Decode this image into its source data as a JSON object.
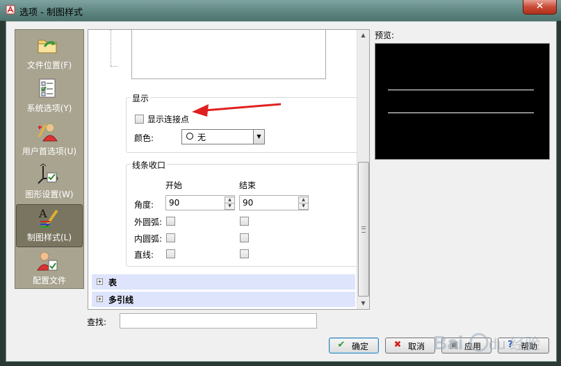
{
  "window": {
    "title": "选项 - 制图样式",
    "close_label": "✕"
  },
  "nav": {
    "items": [
      {
        "label": "文件位置(F)",
        "icon": "folder-icon",
        "selected": false
      },
      {
        "label": "系统选项(Y)",
        "icon": "checklist-icon",
        "selected": false
      },
      {
        "label": "用户首选项(U)",
        "icon": "user-prefs-icon",
        "selected": false
      },
      {
        "label": "图形设置(W)",
        "icon": "graphics-icon",
        "selected": false
      },
      {
        "label": "制图样式(L)",
        "icon": "drafting-style-icon",
        "selected": true
      },
      {
        "label": "配置文件",
        "icon": "profile-icon",
        "selected": false
      }
    ]
  },
  "display_group": {
    "title": "显示",
    "show_connection_points": {
      "label": "显示连接点",
      "checked": false
    },
    "color_label": "颜色:",
    "color_value": "无"
  },
  "line_cap_group": {
    "title": "线条收口",
    "start_header": "开始",
    "end_header": "结束",
    "angle_label": "角度:",
    "angle_start": "90",
    "angle_end": "90",
    "outer_arc_label": "外圆弧:",
    "inner_arc_label": "内圆弧:",
    "straight_label": "直线:"
  },
  "sections": [
    {
      "label": "表",
      "expander": "+"
    },
    {
      "label": "多引线",
      "expander": "+"
    }
  ],
  "preview": {
    "label": "预览:"
  },
  "search": {
    "label": "查找:",
    "value": "",
    "placeholder": ""
  },
  "buttons": {
    "ok": "确定",
    "cancel": "取消",
    "apply": "应用",
    "help": "帮助"
  },
  "watermark": {
    "text": "Bai",
    "text2": "经验",
    "suffix": "du"
  },
  "colors": {
    "accent_red": "#e02020",
    "nav_bg": "#a9a490",
    "section_bg": "#dde4fb"
  }
}
